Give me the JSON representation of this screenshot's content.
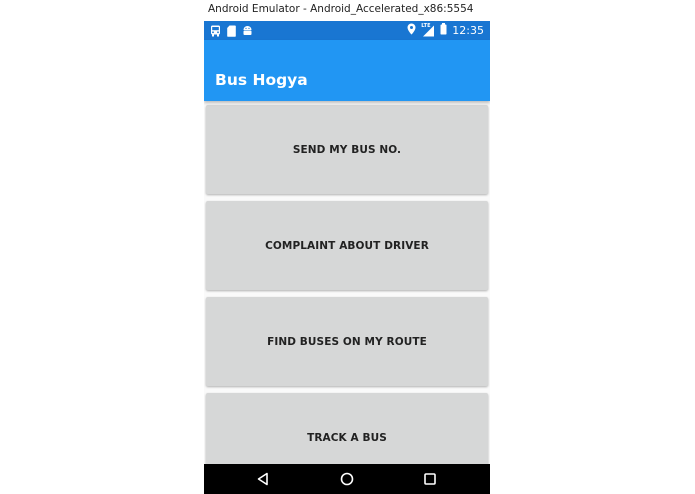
{
  "window": {
    "title": "Android Emulator - Android_Accelerated_x86:5554"
  },
  "status_bar": {
    "time": "12:35",
    "network_label": "LTE",
    "left_icons": [
      "bus-icon",
      "sim-card-icon",
      "android-icon"
    ],
    "right_icons": [
      "location-icon",
      "signal-icon",
      "battery-icon"
    ],
    "color": "#1976d2"
  },
  "app_bar": {
    "title": "Bus Hogya",
    "color": "#2196f3"
  },
  "buttons": [
    {
      "label": "SEND MY BUS NO."
    },
    {
      "label": "COMPLAINT ABOUT DRIVER"
    },
    {
      "label": "FIND BUSES ON MY ROUTE"
    },
    {
      "label": "TRACK A BUS"
    }
  ],
  "nav_bar": {
    "icons": [
      "back-icon",
      "home-icon",
      "recents-icon"
    ],
    "color": "#000000"
  },
  "button_color": "#d6d7d7"
}
